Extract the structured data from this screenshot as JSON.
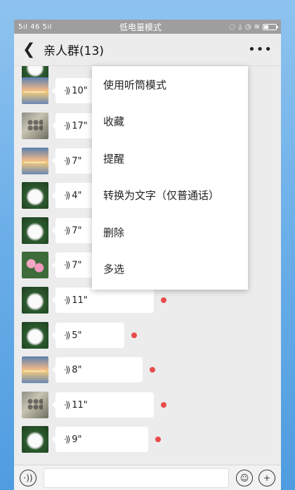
{
  "statusbar": {
    "left_text": "5ıl 46 5ıl",
    "center_text": "低电量模式",
    "icons": [
      "nfc-icon",
      "alarm-icon",
      "clock-icon",
      "wifi-icon",
      "battery-icon"
    ]
  },
  "header": {
    "back_icon": "chevron-left-icon",
    "title": "亲人群(13)",
    "more_icon": "more-dots-icon"
  },
  "messages": [
    {
      "avatar": "sunset",
      "duration": "10\"",
      "unread": false
    },
    {
      "avatar": "group",
      "duration": "17\"",
      "unread": false
    },
    {
      "avatar": "sunset",
      "duration": "7\"",
      "unread": false
    },
    {
      "avatar": "lotus",
      "duration": "4\"",
      "unread": false
    },
    {
      "avatar": "lotus",
      "duration": "7\"",
      "unread": false
    },
    {
      "avatar": "pink",
      "duration": "7\"",
      "unread": false
    },
    {
      "avatar": "lotus",
      "duration": "11\"",
      "unread": true
    },
    {
      "avatar": "lotus",
      "duration": "5\"",
      "unread": true
    },
    {
      "avatar": "sunset",
      "duration": "8\"",
      "unread": true
    },
    {
      "avatar": "group",
      "duration": "11\"",
      "unread": true
    },
    {
      "avatar": "lotus",
      "duration": "9\"",
      "unread": true
    }
  ],
  "context_menu": {
    "items": [
      "使用听筒模式",
      "收藏",
      "提醒",
      "转换为文字（仅普通话）",
      "删除",
      "多选"
    ]
  },
  "inputbar": {
    "voice_icon": "voice-toggle-icon",
    "emoji_icon": "emoji-icon",
    "plus_icon": "plus-icon"
  },
  "colors": {
    "unread_dot": "#e84b4b",
    "header_bg": "#ececec",
    "statusbar_bg": "#9e9e9e"
  }
}
